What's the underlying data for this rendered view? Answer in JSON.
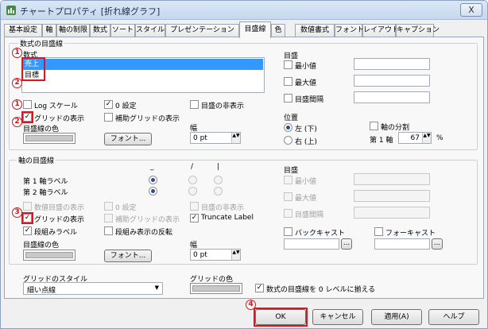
{
  "window": {
    "title": "チャートプロパティ [折れ線グラフ]",
    "close_label": "X"
  },
  "tabs": [
    {
      "label": "基本設定"
    },
    {
      "label": "軸"
    },
    {
      "label": "軸の制限"
    },
    {
      "label": "数式"
    },
    {
      "label": "ソート"
    },
    {
      "label": "スタイル"
    },
    {
      "label": "プレゼンテーション"
    },
    {
      "label": "目盛線"
    },
    {
      "label": "色"
    },
    {
      "label": "数値書式"
    },
    {
      "label": "フォント"
    },
    {
      "label": "レイアウト"
    },
    {
      "label": "キャプション"
    }
  ],
  "expr_gridlines": {
    "group_label": "数式の目盛線",
    "list_label": "数式",
    "items": [
      "売上",
      "目標"
    ],
    "log_scale": "Log スケール",
    "zero_setting": "0 設定",
    "hide_scale": "目盛の非表示",
    "show_grid": "グリッドの表示",
    "show_minor_grid": "補助グリッドの表示",
    "scale_color_label": "目盛線の色",
    "font_button": "フォント...",
    "width_label": "幅",
    "width_value": "0 pt",
    "scale": {
      "label": "目盛",
      "min": "最小値",
      "max": "最大値",
      "interval": "目盛間隔"
    },
    "position": {
      "label": "位置",
      "left": "左 (下)",
      "right": "右 (上)"
    },
    "split_axis": "軸の分割",
    "primary_axis": "第 1 軸",
    "split_value": "67",
    "split_unit": "%"
  },
  "axis_gridlines": {
    "group_label": "軸の目盛線",
    "col_headers": [
      "_",
      "/",
      "|"
    ],
    "row_primary": "第 1 軸ラベル",
    "row_secondary": "第 2 軸ラベル",
    "show_numeric_scale": "数値目盛の表示",
    "zero_setting": "0 設定",
    "hide_scale": "目盛の非表示",
    "show_grid": "グリッドの表示",
    "show_minor_grid": "補助グリッドの表示",
    "truncate_label": "Truncate Label",
    "stagger_labels": "段組みラベル",
    "reverse_stagger": "段組み表示の反転",
    "scale_color_label": "目盛線の色",
    "font_button": "フォント...",
    "width_label": "幅",
    "width_value": "0 pt",
    "scale": {
      "label": "目盛",
      "min": "最小値",
      "max": "最大値",
      "interval": "目盛間隔"
    },
    "backcast": "バックキャスト",
    "forecast": "フォーキャスト",
    "ellipsis": "..."
  },
  "grid_style": {
    "label": "グリッドのスタイル",
    "value": "細い点線"
  },
  "grid_color": {
    "label": "グリッドの色"
  },
  "align_zero": "数式の目盛線を 0 レベルに揃える",
  "footer": {
    "ok": "OK",
    "cancel": "キャンセル",
    "apply": "適用(A)",
    "help": "ヘルプ"
  },
  "markers": {
    "m1": "1",
    "m2": "2",
    "m3": "3",
    "m4": "4"
  },
  "colors": {
    "highlight": "#e0141e",
    "selection": "#3399ff"
  }
}
